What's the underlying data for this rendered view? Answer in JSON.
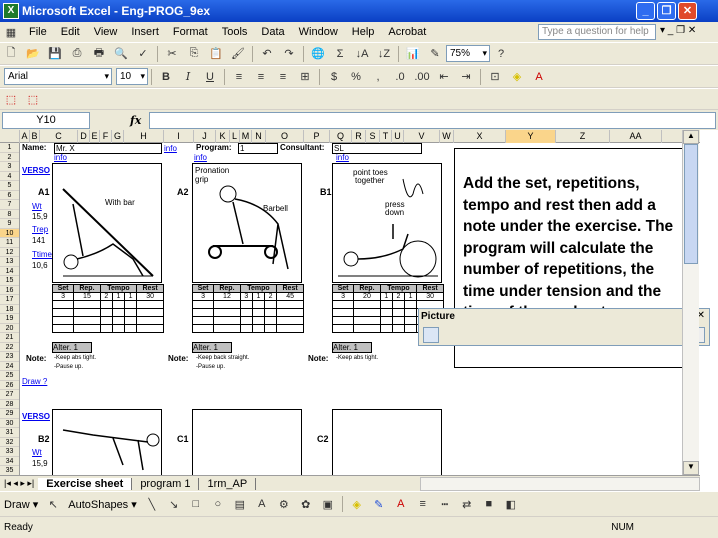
{
  "window": {
    "title": "Microsoft Excel - Eng-PROG_9ex"
  },
  "menu": [
    "File",
    "Edit",
    "View",
    "Insert",
    "Format",
    "Tools",
    "Data",
    "Window",
    "Help",
    "Acrobat"
  ],
  "ask_placeholder": "Type a question for help",
  "toolbar": {
    "zoom": "75%",
    "font": "Arial",
    "size": "10"
  },
  "formula": {
    "name_box": "Y10",
    "fx": "fx"
  },
  "columns": [
    "A",
    "B",
    "C",
    "D",
    "E",
    "F",
    "G",
    "H",
    "I",
    "J",
    "K",
    "L",
    "M",
    "N",
    "O",
    "P",
    "Q",
    "R",
    "S",
    "T",
    "U",
    "V",
    "W",
    "X",
    "Y",
    "Z",
    "AA"
  ],
  "rows": [
    "1",
    "2",
    "3",
    "4",
    "5",
    "6",
    "7",
    "8",
    "9",
    "10",
    "11",
    "12",
    "13",
    "14",
    "15",
    "16",
    "17",
    "18",
    "19",
    "20",
    "21",
    "22",
    "23",
    "24",
    "25",
    "26",
    "27",
    "28",
    "29",
    "30",
    "31",
    "32",
    "33",
    "34",
    "35"
  ],
  "sheet": {
    "name_label": "Name:",
    "name_value": "Mr. X",
    "info": "info",
    "program_label": "Program:",
    "program_value": "1",
    "consultant_label": "Consultant:",
    "consultant_value": "SL",
    "version": "VERSO",
    "a1": "A1",
    "a2": "A2",
    "b1": "B1",
    "b2": "B2",
    "c1": "C1",
    "c2": "C2",
    "left_links": [
      "Wt",
      "15,9",
      "Trep",
      "141",
      "Ttime",
      "10,6"
    ],
    "left_links_b2": [
      "Wt",
      "15,9"
    ],
    "table_headers": [
      "Set",
      "Rep.",
      "Tempo",
      "Rest"
    ],
    "rows_a1": [
      "3",
      "15",
      "2",
      "1",
      "1",
      "30"
    ],
    "rows_a2": [
      "3",
      "12",
      "3",
      "1",
      "2",
      "45"
    ],
    "rows_b1": [
      "3",
      "20",
      "1",
      "2",
      "1",
      "30"
    ],
    "alter": "Alter.",
    "alter_val": "1",
    "note": "Note:",
    "notes_a1": [
      "-Keep abs tight.",
      "-Pause up."
    ],
    "notes_a2": [
      "-Keep back straight.",
      "-Pause up."
    ],
    "notes_b1": [
      "-Keep abs tight."
    ],
    "draw": "Draw ?",
    "img_labels": {
      "a1": "With bar",
      "a2_pron": "Pronation",
      "a2_grip": "grip",
      "a2_barbell": "Barbell",
      "b1_toes": "point toes",
      "b1_together": "together",
      "b1_press": "press",
      "b1_down": "down"
    }
  },
  "callout": "Add the set, repetitions, tempo and rest then add a note under the exercise. The program will calculate the number of repetitions, the time under tension and the time of the workout.",
  "picture_toolbar": "Picture",
  "tabs": [
    "Exercise sheet",
    "program 1",
    "1rm_AP"
  ],
  "draw": {
    "draw_label": "Draw",
    "autoshapes": "AutoShapes"
  },
  "status": {
    "left": "Ready",
    "right": "NUM"
  }
}
